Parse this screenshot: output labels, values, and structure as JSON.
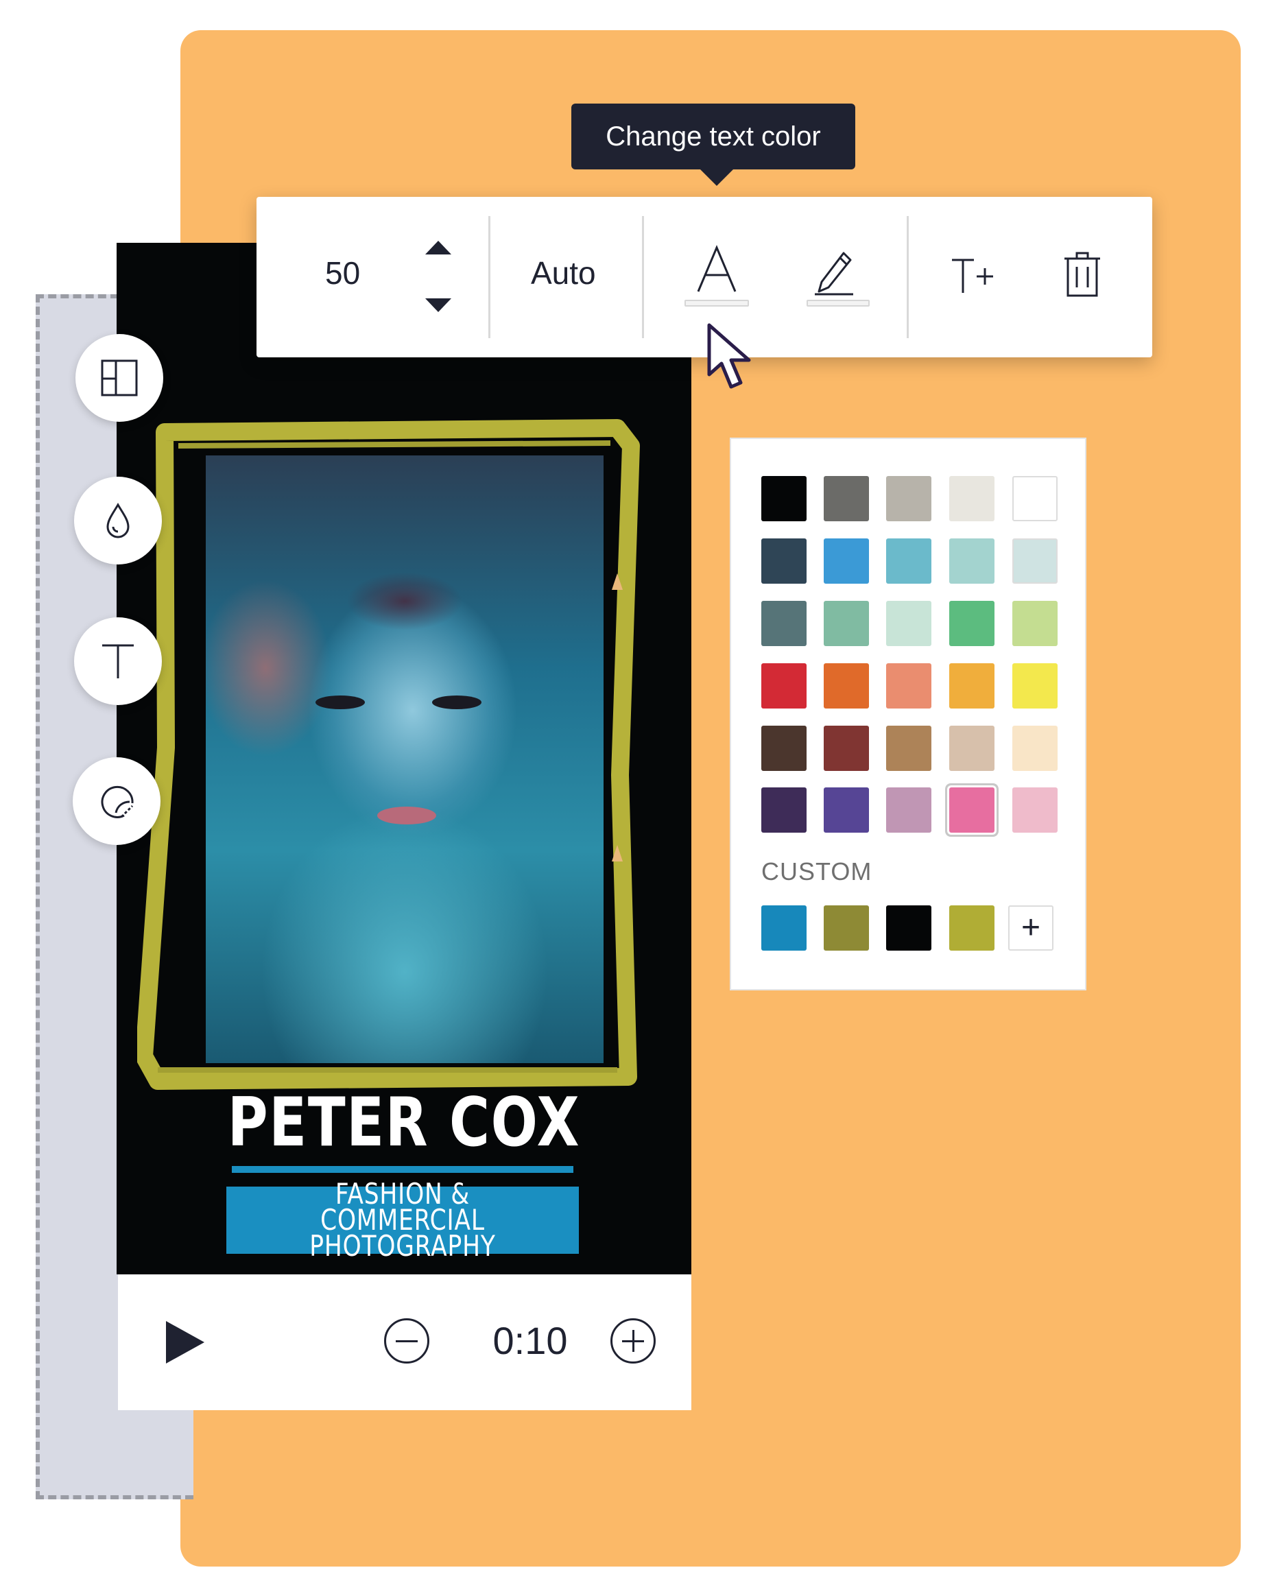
{
  "tooltip": {
    "text": "Change text color"
  },
  "toolbar": {
    "font_size": "50",
    "line_height": "Auto",
    "icons": [
      "font-size-up-arrow",
      "font-size-down-arrow",
      "text-color-icon",
      "highlight-color-icon",
      "add-text-icon",
      "delete-icon"
    ]
  },
  "side_tools": [
    "layout-icon",
    "color-drop-icon",
    "text-tool-icon",
    "sticker-icon"
  ],
  "poster": {
    "name": "PETER COX",
    "subtitle": "FASHION & COMMERCIAL\nPHOTOGRAPHY",
    "accent_color": "#1a8fc1",
    "frame_color": "#b6b23a"
  },
  "playback": {
    "time": "0:10"
  },
  "palette": {
    "rows": [
      [
        "#050607",
        "#6b6b68",
        "#b7b3aa",
        "#e8e6df",
        "#ffffff"
      ],
      [
        "#2f4556",
        "#3b9ad6",
        "#6bbacb",
        "#a3d3cf",
        "#cfe3e2"
      ],
      [
        "#567478",
        "#80bba2",
        "#c8e4d7",
        "#5cbc7f",
        "#c4dd91"
      ],
      [
        "#d32a35",
        "#e06a2a",
        "#ea8d6f",
        "#f0ae3c",
        "#f3e84d"
      ],
      [
        "#4b362d",
        "#803532",
        "#ad8358",
        "#d7c0ab",
        "#f9e5c7"
      ],
      [
        "#3e2c58",
        "#564595",
        "#c096b4",
        "#e76ea0",
        "#efbbcb"
      ]
    ],
    "selected": "#e76ea0",
    "custom_label": "CUSTOM",
    "custom_colors": [
      "#1788bb",
      "#8e8a35",
      "#050607",
      "#b0ad35"
    ],
    "add_label": "+"
  }
}
